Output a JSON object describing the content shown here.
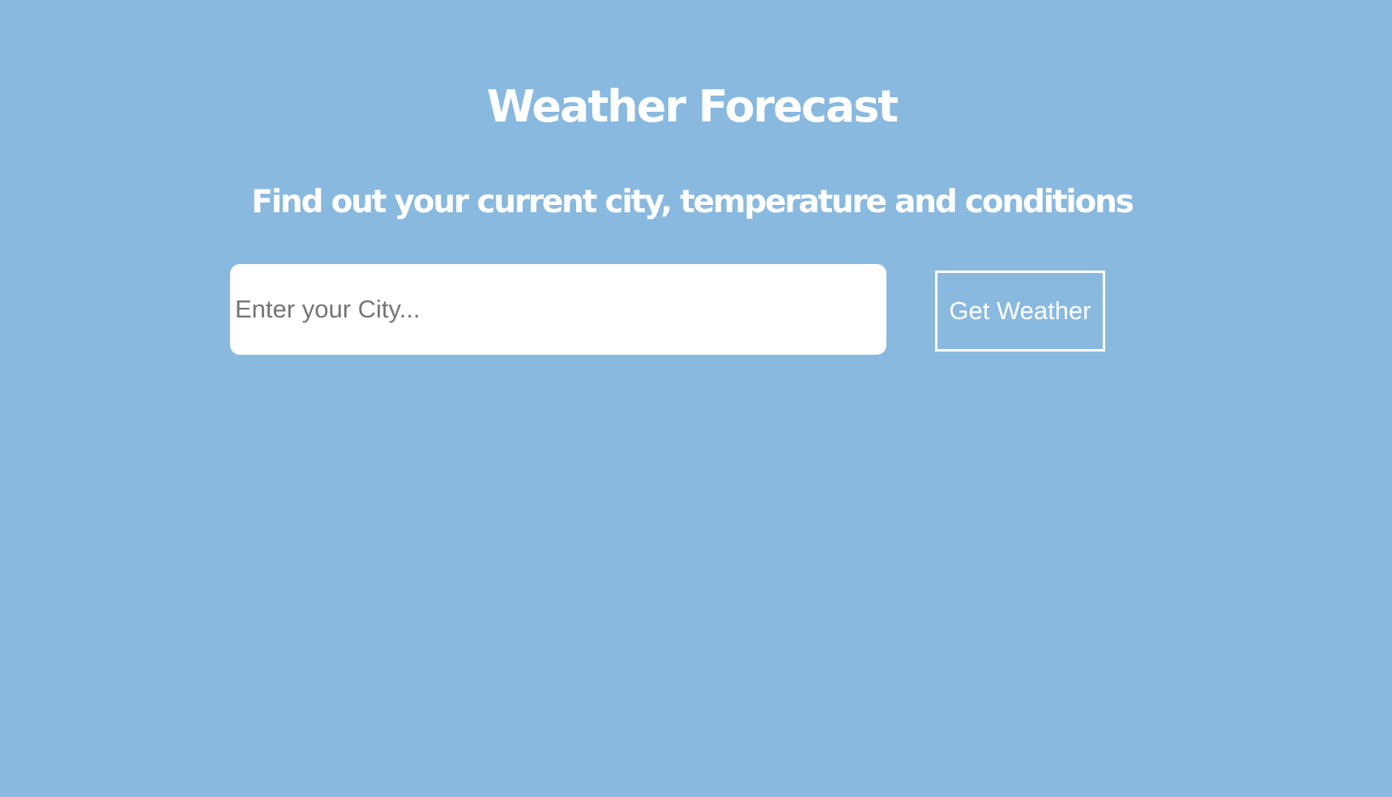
{
  "header": {
    "title": "Weather Forecast",
    "subtitle": "Find out your current city, temperature and conditions"
  },
  "search": {
    "placeholder": "Enter your City...",
    "value": "",
    "button_label": "Get Weather"
  },
  "colors": {
    "background": "#89b9df",
    "text": "#ffffff",
    "input_background": "#ffffff",
    "placeholder": "#757575"
  }
}
